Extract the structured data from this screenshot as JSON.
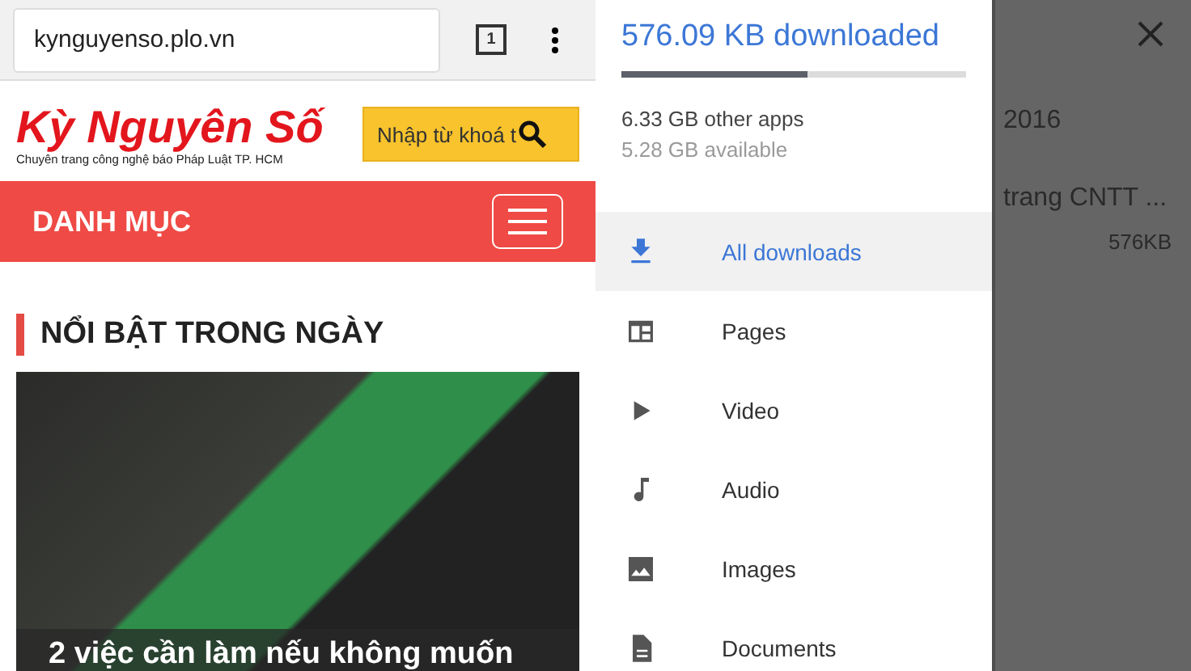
{
  "browser": {
    "address": "kynguyenso.plo.vn",
    "tab_count": "1"
  },
  "site": {
    "logo": "Kỳ Nguyên Số",
    "tagline": "Chuyên trang công nghệ báo Pháp Luật TP. HCM",
    "search": {
      "placeholder": "Nhập từ khoá t"
    },
    "nav_label": "DANH MỤC",
    "section_title": "NỔI BẬT TRONG NGÀY",
    "article": {
      "headline": "2 việc cần làm nếu không muốn"
    }
  },
  "drawer": {
    "title": "576.09 KB downloaded",
    "usage": {
      "level": 0.54
    },
    "other_apps": "6.33 GB other apps",
    "available": "5.28 GB available",
    "items": [
      {
        "kind": "download",
        "label": "All downloads",
        "selected": true
      },
      {
        "kind": "pages",
        "label": "Pages",
        "selected": false
      },
      {
        "kind": "video",
        "label": "Video",
        "selected": false
      },
      {
        "kind": "audio",
        "label": "Audio",
        "selected": false
      },
      {
        "kind": "images",
        "label": "Images",
        "selected": false
      },
      {
        "kind": "documents",
        "label": "Documents",
        "selected": false
      }
    ]
  },
  "background_list": {
    "texts": [
      "2016",
      "trang CNTT ...",
      "576KB"
    ]
  }
}
